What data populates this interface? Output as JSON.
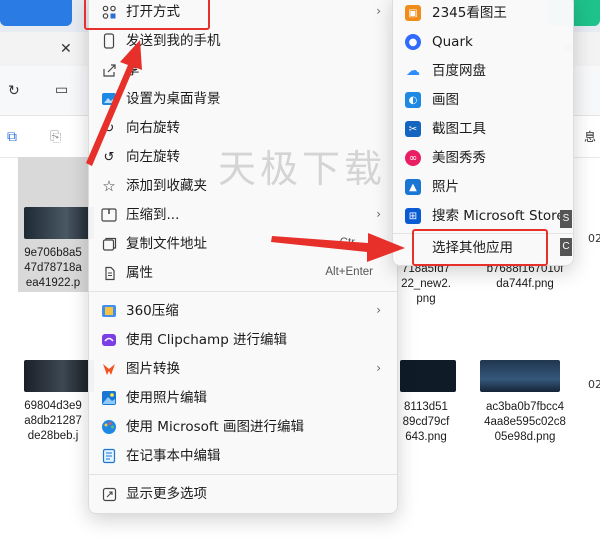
{
  "watermark": "天极下载",
  "context_menu": {
    "items": [
      {
        "id": "open-with",
        "label": "打开方式",
        "icon": "open-with-icon",
        "arrow": true
      },
      {
        "id": "send-to-phone",
        "label": "发送到我的手机",
        "icon": "phone-icon"
      },
      {
        "id": "share",
        "label": "享",
        "icon": "share-icon"
      },
      {
        "id": "set-wallpaper",
        "label": "设置为桌面背景",
        "icon": "wallpaper-icon"
      },
      {
        "id": "rotate-right",
        "label": "向右旋转",
        "icon": "rotate-right-icon"
      },
      {
        "id": "rotate-left",
        "label": "向左旋转",
        "icon": "rotate-left-icon"
      },
      {
        "id": "add-favorite",
        "label": "添加到收藏夹",
        "icon": "star-icon"
      },
      {
        "id": "compress-to",
        "label": "压缩到...",
        "icon": "zip-icon",
        "arrow": true
      },
      {
        "id": "copy-path",
        "label": "复制文件地址",
        "icon": "copy-path-icon",
        "shortcut": "Ctr"
      },
      {
        "id": "properties",
        "label": "属性",
        "icon": "properties-icon",
        "shortcut": "Alt+Enter"
      },
      {
        "id": "360-zip",
        "label": "360压缩",
        "icon": "360-zip-icon",
        "arrow": true
      },
      {
        "id": "clipchamp",
        "label": "使用 Clipchamp 进行编辑",
        "icon": "clipchamp-icon"
      },
      {
        "id": "image-convert",
        "label": "图片转换",
        "icon": "image-convert-icon",
        "arrow": true
      },
      {
        "id": "photos-edit",
        "label": "使用照片编辑",
        "icon": "photos-icon"
      },
      {
        "id": "paint-edit",
        "label": "使用 Microsoft 画图进行编辑",
        "icon": "paint-icon"
      },
      {
        "id": "notepad-edit",
        "label": "在记事本中编辑",
        "icon": "notepad-icon"
      },
      {
        "id": "more-options",
        "label": "显示更多选项",
        "icon": "more-options-icon"
      }
    ]
  },
  "open_with_submenu": {
    "items": [
      {
        "id": "2345viewer",
        "label": "2345看图王",
        "icon": "2345-viewer-icon",
        "color": "#f08c1a"
      },
      {
        "id": "quark",
        "label": "Quark",
        "icon": "quark-icon",
        "color": "#2f6bff"
      },
      {
        "id": "baidu-netdisk",
        "label": "百度网盘",
        "icon": "baidu-netdisk-icon",
        "color": "#2f8cff"
      },
      {
        "id": "paint",
        "label": "画图",
        "icon": "paint-icon",
        "color": "#1e88e5"
      },
      {
        "id": "snipping",
        "label": "截图工具",
        "icon": "snipping-tool-icon",
        "color": "#1565c0"
      },
      {
        "id": "meitu",
        "label": "美图秀秀",
        "icon": "meitu-icon",
        "color": "#e91e63"
      },
      {
        "id": "photos",
        "label": "照片",
        "icon": "photos-icon",
        "color": "#1976d2"
      },
      {
        "id": "store-search",
        "label": "搜索 Microsoft Store",
        "icon": "store-icon",
        "color": "#0a5bd3",
        "key": "S"
      },
      {
        "id": "choose-other",
        "label": "选择其他应用",
        "icon": "",
        "key": "C"
      }
    ]
  },
  "files": {
    "left": [
      {
        "name": "9e706b8a5\n47d78718a\nea41922.p",
        "selected": true
      },
      {
        "name": "69804d3e9\na8db21287\nde28beb.j"
      }
    ],
    "right": [
      {
        "name": "718a5fd7\n22_new2.\npng"
      },
      {
        "name": "b7688f167010f\nda744f.png"
      },
      {
        "name": "8113d51\n89cd79cf\n643.png"
      },
      {
        "name": "ac3ba0b7fbcc4\n4aa8e595c02c8\n05e98d.png"
      }
    ]
  },
  "partial_text": {
    "right_toolbar": "息",
    "right_edge_1": "02",
    "right_edge_2": "02"
  }
}
